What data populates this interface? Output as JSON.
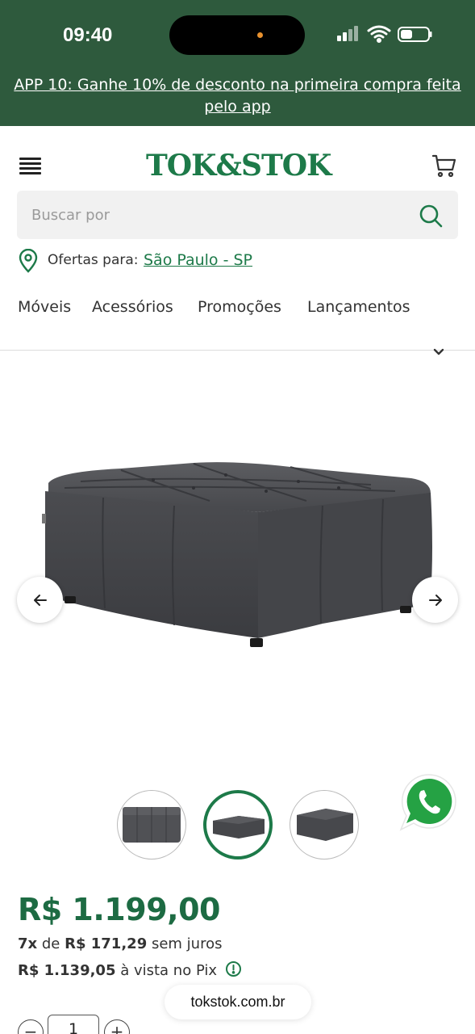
{
  "status_bar": {
    "time": "09:40"
  },
  "promo_banner": {
    "text": "APP 10: Ganhe 10% de desconto na primeira compra feita pelo app"
  },
  "header": {
    "logo_text": "TOK&STOK",
    "brand_color": "#1d7a49"
  },
  "search": {
    "placeholder": "Buscar por",
    "value": ""
  },
  "location": {
    "label": "Ofertas para:",
    "city": "São Paulo - SP"
  },
  "nav": {
    "items": [
      {
        "label": "Móveis"
      },
      {
        "label": "Acessórios"
      },
      {
        "label": "Promoções"
      },
      {
        "label": "Lançamentos"
      }
    ]
  },
  "product": {
    "price": "R$ 1.199,00",
    "installments": {
      "count": "7x",
      "connector": "de",
      "amount": "R$ 171,29",
      "suffix": "sem juros"
    },
    "pix": {
      "amount": "R$ 1.139,05",
      "suffix": "à vista no Pix"
    },
    "quantity": "1",
    "thumbnails_selected_index": 1,
    "thumbnail_count": 3
  },
  "browser": {
    "url": "tokstok.com.br"
  },
  "colors": {
    "top_band": "#2e5a3d",
    "price": "#1d6b43",
    "accent": "#1d7a49",
    "whatsapp": "#25a244"
  }
}
